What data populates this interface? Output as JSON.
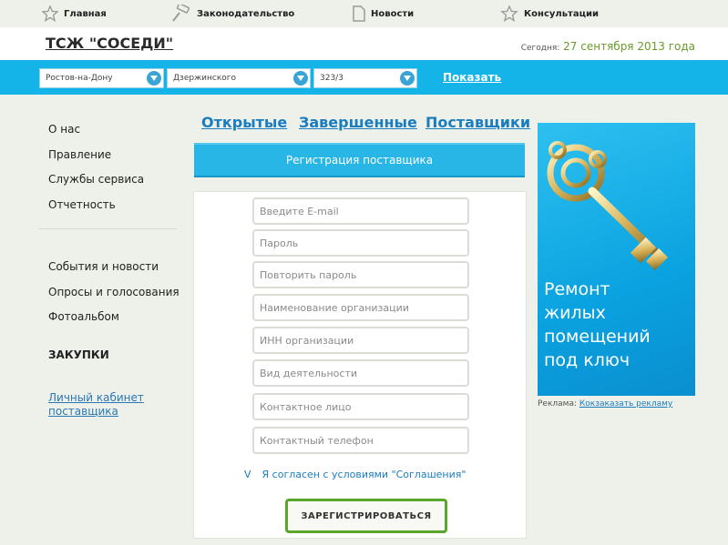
{
  "topnav": {
    "items": [
      {
        "label": "Главная",
        "icon": "star-icon"
      },
      {
        "label": "Законодательство",
        "icon": "gavel-icon"
      },
      {
        "label": "Новости",
        "icon": "document-icon"
      },
      {
        "label": "Консультации",
        "icon": "star-outline-icon"
      }
    ]
  },
  "header": {
    "title": "ТСЖ \"СОСЕДИ\"",
    "date_label": "Сегодня:",
    "date_value": "27 сентября 2013 года"
  },
  "filters": {
    "city": "Ростов-на-Дону",
    "street": "Дзержинского",
    "house": "323/3",
    "show_label": "Показать"
  },
  "sidebar": {
    "group1": [
      "О нас",
      "Правление",
      "Службы сервиса",
      "Отчетность"
    ],
    "group2": [
      "События и новости",
      "Опросы и голосования",
      "Фотоальбом"
    ],
    "purchases": "ЗАКУПКИ",
    "cabinet_line1": "Личный кабинет",
    "cabinet_line2": "поставщика"
  },
  "tabs": [
    "Открытые",
    "Завершенные",
    "Поставщики"
  ],
  "form": {
    "banner": "Регистрация поставщика",
    "fields": [
      "Введите E-mail",
      "Пароль",
      "Повторить пароль",
      "Наименование организации",
      "ИНН организации",
      "Вид деятельности",
      "Контактное лицо",
      "Контактный телефон"
    ],
    "agree_mark": "V",
    "agree_text": "Я согласен с условиями \"Соглашения\"",
    "submit": "ЗАРЕГИСТРИРОВАТЬСЯ"
  },
  "ad": {
    "line1": "Ремонт",
    "line2": "жилых",
    "line3": "помещений",
    "line4": "под ключ",
    "note_label": "Реклама:",
    "note_link": "Кокзаказать рекламу"
  },
  "colors": {
    "accent_blue": "#14b3e8",
    "link_blue": "#1a7dbf",
    "button_border": "#5aa62a",
    "date_green": "#6a9a2a"
  }
}
